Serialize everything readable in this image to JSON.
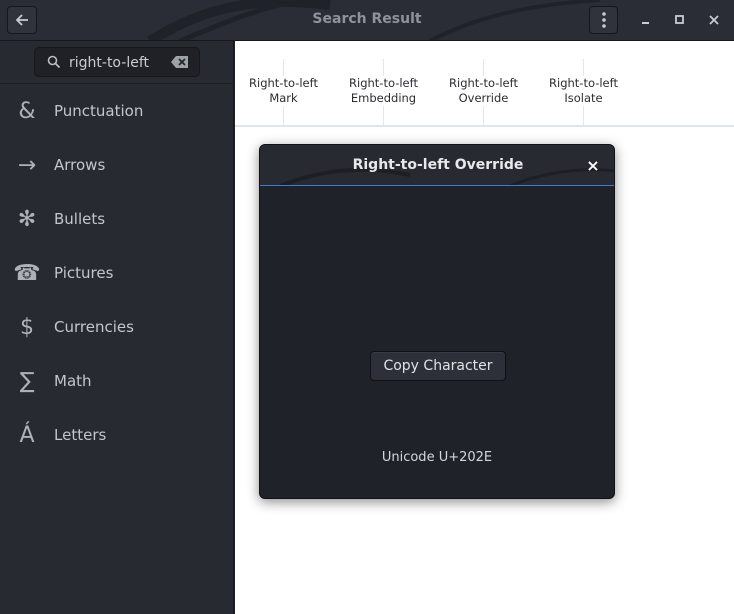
{
  "window": {
    "title": "Search Result"
  },
  "search": {
    "value": "right-to-left"
  },
  "sidebar": {
    "items": [
      {
        "label": "Punctuation",
        "glyph": "&",
        "icon": "ampersand-icon"
      },
      {
        "label": "Arrows",
        "glyph": "→",
        "icon": "arrow-right-icon"
      },
      {
        "label": "Bullets",
        "glyph": "✻",
        "icon": "bullet-asterisk-icon"
      },
      {
        "label": "Pictures",
        "glyph": "☎",
        "icon": "telephone-icon"
      },
      {
        "label": "Currencies",
        "glyph": "$",
        "icon": "dollar-icon"
      },
      {
        "label": "Math",
        "glyph": "∑",
        "icon": "sigma-icon"
      },
      {
        "label": "Letters",
        "glyph": "Á",
        "icon": "letter-a-acute-icon"
      }
    ]
  },
  "results": [
    {
      "name": "Right-to-left\nMark"
    },
    {
      "name": "Right-to-left\nEmbedding"
    },
    {
      "name": "Right-to-left\nOverride"
    },
    {
      "name": "Right-to-left\nIsolate"
    }
  ],
  "dialog": {
    "title": "Right-to-left Override",
    "close_glyph": "×",
    "copy_label": "Copy Character",
    "codepoint": "Unicode U+202E"
  },
  "colors": {
    "accent": "#3a7bd5",
    "sidebar_bg": "#272a31",
    "main_bg": "#ffffff",
    "dialog_bg": "#20222a"
  }
}
